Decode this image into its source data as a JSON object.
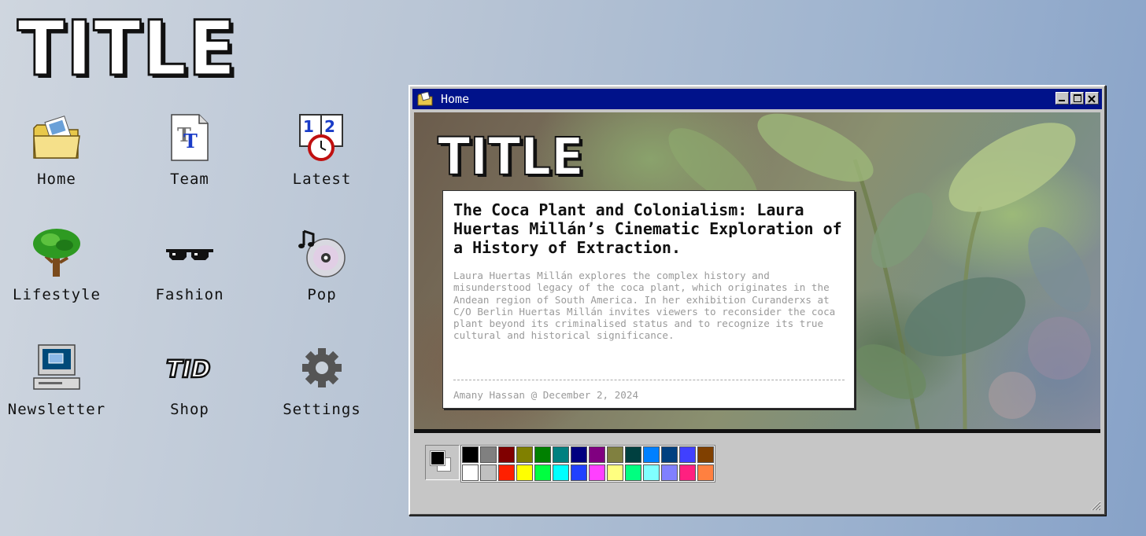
{
  "desktop": {
    "logo": "TITLE",
    "icons": [
      {
        "label": "Home",
        "icon": "folder-icon"
      },
      {
        "label": "Team",
        "icon": "font-file-icon"
      },
      {
        "label": "Latest",
        "icon": "calendar-clock-icon"
      },
      {
        "label": "Lifestyle",
        "icon": "tree-icon"
      },
      {
        "label": "Fashion",
        "icon": "sunglasses-icon"
      },
      {
        "label": "Pop",
        "icon": "music-cd-icon"
      },
      {
        "label": "Newsletter",
        "icon": "computer-icon"
      },
      {
        "label": "Shop",
        "icon": "title-logo-icon"
      },
      {
        "label": "Settings",
        "icon": "gear-icon"
      }
    ]
  },
  "window": {
    "title": "Home",
    "controls": [
      "minimize",
      "maximize",
      "close"
    ],
    "content_logo": "TITLE",
    "article": {
      "headline": "The Coca Plant and Colonialism: Laura Huertas Millán’s Cinematic Exploration of a History of Extraction.",
      "excerpt": "Laura Huertas Millán explores the complex history and misunderstood legacy of the coca plant, which originates in the Andean region of South America. In her exhibition Curanderxs at C/O Berlin Huertas Millán invites viewers to reconsider the coca plant beyond its criminalised status and to recognize its true cultural and historical significance.",
      "byline": "Amany Hassan @ December 2, 2024"
    },
    "palette": {
      "foreground": "#000000",
      "background": "#ffffff",
      "top_row": [
        "#000000",
        "#808080",
        "#800000",
        "#808000",
        "#008000",
        "#008080",
        "#000080",
        "#800080",
        "#808040",
        "#004040",
        "#0080ff",
        "#004080",
        "#4040ff",
        "#804000"
      ],
      "bottom_row": [
        "#ffffff",
        "#c0c0c0",
        "#ff2000",
        "#ffff00",
        "#00ff40",
        "#00ffff",
        "#2040ff",
        "#ff40ff",
        "#ffff80",
        "#00ff80",
        "#80ffff",
        "#8080ff",
        "#ff2080",
        "#ff8040"
      ]
    }
  }
}
